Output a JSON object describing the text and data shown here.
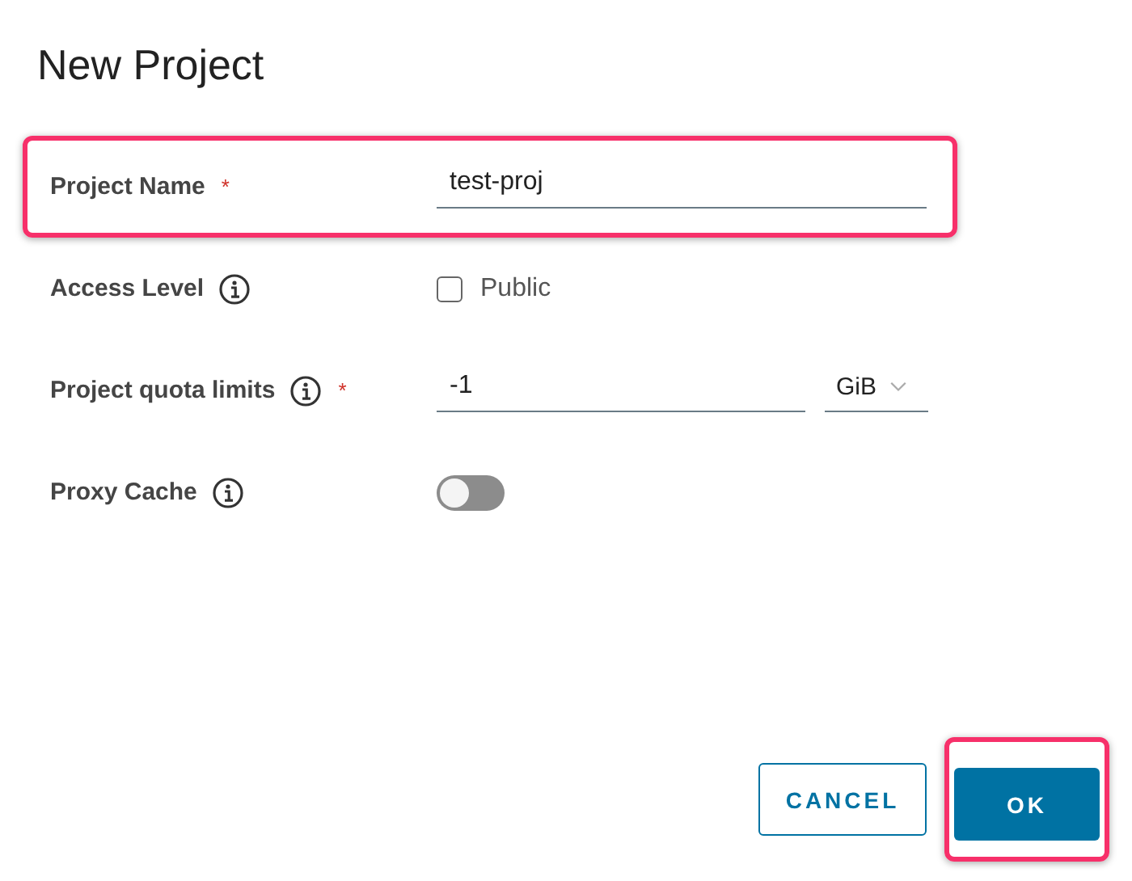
{
  "dialog": {
    "title": "New Project"
  },
  "fields": [
    {
      "kind": "text",
      "label": "Project Name",
      "required_mark": "*",
      "info": false,
      "value": "test-proj",
      "highlighted": true
    },
    {
      "kind": "checkbox",
      "label": "Access Level",
      "info": true,
      "option": "Public",
      "checked": false,
      "highlighted": false
    },
    {
      "kind": "quota",
      "label": "Project quota limits",
      "info": true,
      "required_mark": "*",
      "value": "-1",
      "unit": "GiB",
      "highlighted": false
    },
    {
      "kind": "toggle",
      "label": "Proxy Cache",
      "info": true,
      "on": false,
      "highlighted": false
    }
  ],
  "buttons": [
    {
      "kind": "secondary",
      "label": "CANCEL",
      "highlighted": false
    },
    {
      "kind": "primary",
      "label": "OK",
      "highlighted": true
    }
  ]
}
